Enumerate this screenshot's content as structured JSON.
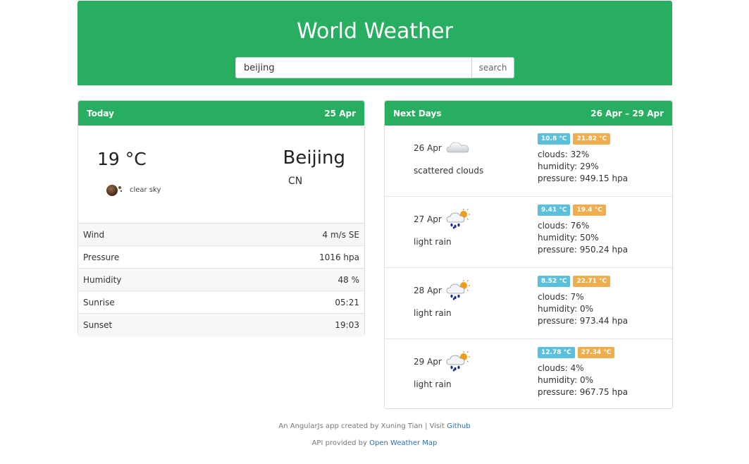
{
  "app": {
    "title": "World Weather"
  },
  "search": {
    "value": "beijing",
    "button_label": "search"
  },
  "today": {
    "header_label": "Today",
    "date": "25 Apr",
    "temperature": "19 °C",
    "city": "Beijing",
    "country": "CN",
    "sky_text": "clear sky",
    "sky_icon": "moon-clear-icon",
    "rows": [
      {
        "label": "Wind",
        "value": "4 m/s SE"
      },
      {
        "label": "Pressure",
        "value": "1016 hpa"
      },
      {
        "label": "Humidity",
        "value": "48 %"
      },
      {
        "label": "Sunrise",
        "value": "05:21"
      },
      {
        "label": "Sunset",
        "value": "19:03"
      }
    ]
  },
  "next": {
    "header_label": "Next Days",
    "range": "26 Apr – 29 Apr",
    "days": [
      {
        "date": "26 Apr",
        "desc": "scattered clouds",
        "icon": "cloud-icon",
        "min": "10.8 °C",
        "max": "21.82 °C",
        "clouds": "clouds: 32%",
        "humidity": "humidity: 29%",
        "pressure": "pressure: 949.15 hpa"
      },
      {
        "date": "27 Apr",
        "desc": "light rain",
        "icon": "rain-sun-icon",
        "min": "9.41 °C",
        "max": "19.4 °C",
        "clouds": "clouds: 76%",
        "humidity": "humidity: 50%",
        "pressure": "pressure: 950.24 hpa"
      },
      {
        "date": "28 Apr",
        "desc": "light rain",
        "icon": "rain-sun-icon",
        "min": "8.52 °C",
        "max": "22.71 °C",
        "clouds": "clouds: 7%",
        "humidity": "humidity: 0%",
        "pressure": "pressure: 973.44 hpa"
      },
      {
        "date": "29 Apr",
        "desc": "light rain",
        "icon": "rain-sun-icon",
        "min": "12.78 °C",
        "max": "27.34 °C",
        "clouds": "clouds: 4%",
        "humidity": "humidity: 0%",
        "pressure": "pressure: 967.75 hpa"
      }
    ]
  },
  "footer": {
    "credit_prefix": "An AngularJs app created by Xuning Tian | Visit ",
    "github_link": "Github",
    "api_prefix": "API provided by ",
    "api_link": "Open Weather Map"
  },
  "colors": {
    "brand": "#27ae60",
    "min_badge": "#5bc0de",
    "max_badge": "#f0ad4e",
    "link": "#2a6fb0"
  }
}
